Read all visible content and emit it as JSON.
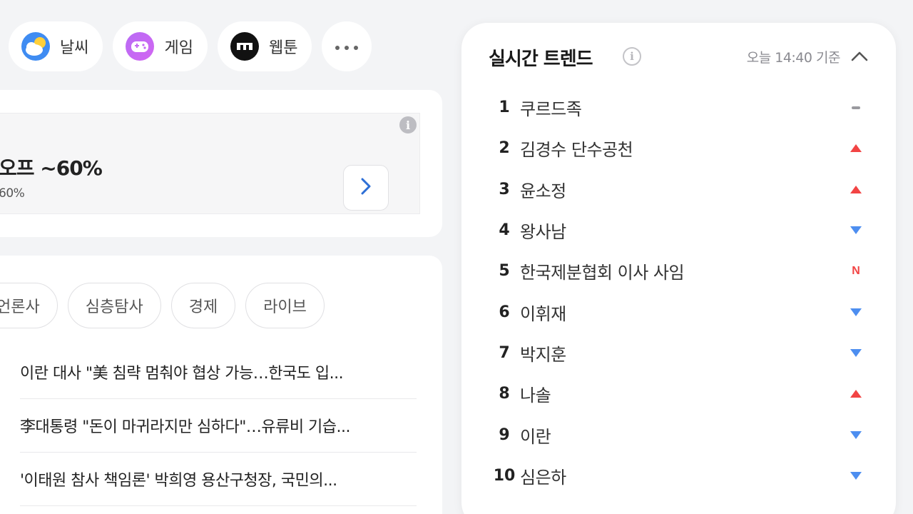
{
  "shortcuts": [
    {
      "label": "날씨",
      "icon": "weather-icon"
    },
    {
      "label": "게임",
      "icon": "game-controller-icon"
    },
    {
      "label": "웹툰",
      "icon": "webtoon-icon"
    },
    {
      "label": "",
      "icon": "more-dots-icon"
    }
  ],
  "ad": {
    "title": "오프 ~60%",
    "subtitle": "60%",
    "arrow_icon": "chevron-right-icon",
    "info_glyph": "i"
  },
  "news": {
    "tabs": [
      "언론사",
      "심층탐사",
      "경제",
      "라이브"
    ],
    "items": [
      "이란 대사 \"美 침략 멈춰야 협상 가능…한국도 입...",
      "李대통령 \"돈이 마귀라지만 심하다\"…유류비 기습...",
      "'이태원 참사 책임론' 박희영 용산구청장, 국민의..."
    ]
  },
  "trends": {
    "title": "실시간 트렌드",
    "info_glyph": "i",
    "timestamp": "오늘 14:40 기준",
    "collapse_icon": "chevron-up-icon",
    "status_colors": {
      "up": "#f24444",
      "down": "#4d8ef0",
      "new": "#f24444",
      "same": "#9a9a9f"
    },
    "items": [
      {
        "rank": "1",
        "keyword": "쿠르드족",
        "status": "same"
      },
      {
        "rank": "2",
        "keyword": "김경수 단수공천",
        "status": "up"
      },
      {
        "rank": "3",
        "keyword": "윤소정",
        "status": "up"
      },
      {
        "rank": "4",
        "keyword": "왕사남",
        "status": "down"
      },
      {
        "rank": "5",
        "keyword": "한국제분협회 이사 사임",
        "status": "new",
        "status_label": "N"
      },
      {
        "rank": "6",
        "keyword": "이휘재",
        "status": "down"
      },
      {
        "rank": "7",
        "keyword": "박지훈",
        "status": "down"
      },
      {
        "rank": "8",
        "keyword": "나솔",
        "status": "up"
      },
      {
        "rank": "9",
        "keyword": "이란",
        "status": "down"
      },
      {
        "rank": "10",
        "keyword": "심은하",
        "status": "down"
      }
    ]
  }
}
